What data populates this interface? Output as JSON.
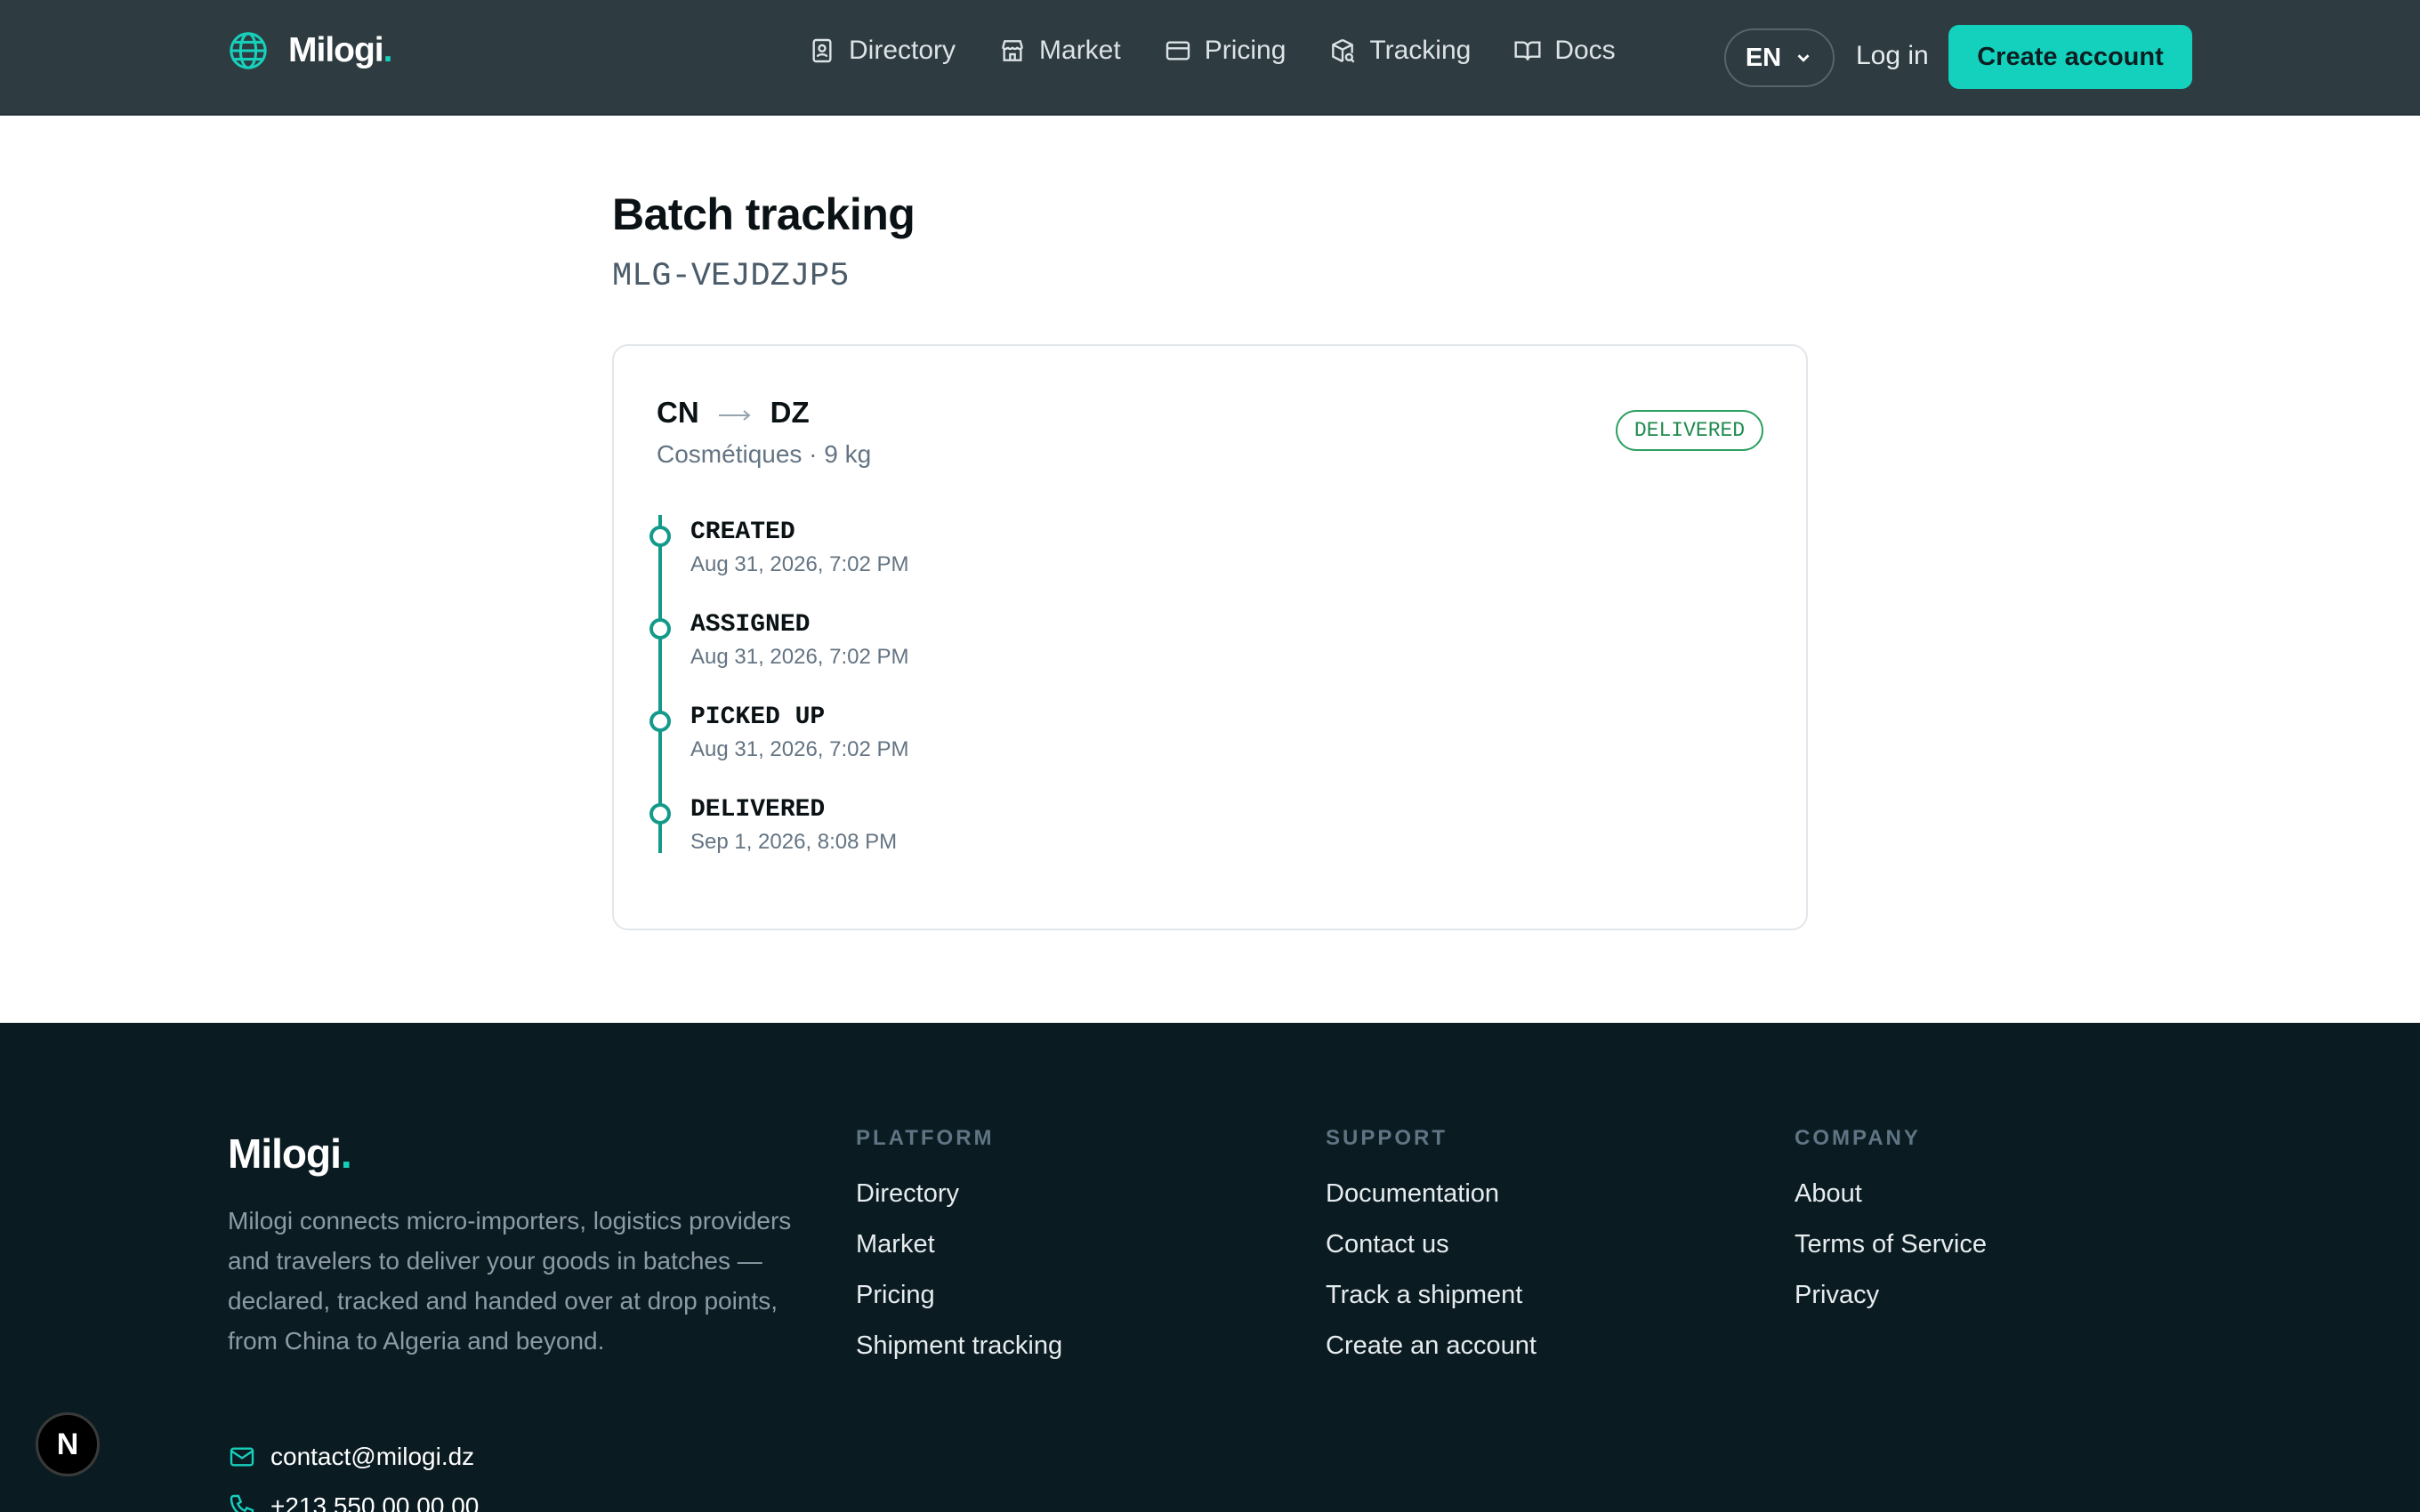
{
  "header": {
    "logo": "Milogi",
    "logo_dot": ".",
    "nav": [
      {
        "label": "Directory",
        "icon": "contact-book-icon"
      },
      {
        "label": "Market",
        "icon": "store-icon"
      },
      {
        "label": "Pricing",
        "icon": "credit-card-icon"
      },
      {
        "label": "Tracking",
        "icon": "package-search-icon"
      },
      {
        "label": "Docs",
        "icon": "book-icon"
      }
    ],
    "language": "EN",
    "login": "Log in",
    "cta": "Create account"
  },
  "main": {
    "title": "Batch tracking",
    "batch_id": "MLG-VEJDZJP5",
    "card": {
      "origin": "CN",
      "destination": "DZ",
      "meta": "Cosmétiques · 9 kg",
      "status": "DELIVERED",
      "events": [
        {
          "label": "CREATED",
          "time": "Aug 31, 2026, 7:02 PM"
        },
        {
          "label": "ASSIGNED",
          "time": "Aug 31, 2026, 7:02 PM"
        },
        {
          "label": "PICKED UP",
          "time": "Aug 31, 2026, 7:02 PM"
        },
        {
          "label": "DELIVERED",
          "time": "Sep 1, 2026, 8:08 PM"
        }
      ]
    }
  },
  "footer": {
    "logo": "Milogi",
    "logo_dot": ".",
    "description": "Milogi connects micro-importers, logistics providers and travelers to deliver your goods in batches — declared, tracked and handed over at drop points, from China to Algeria and beyond.",
    "email": "contact@milogi.dz",
    "phone": "+213 550 00 00 00",
    "columns": [
      {
        "heading": "PLATFORM",
        "links": [
          "Directory",
          "Market",
          "Pricing",
          "Shipment tracking"
        ]
      },
      {
        "heading": "SUPPORT",
        "links": [
          "Documentation",
          "Contact us",
          "Track a shipment",
          "Create an account"
        ]
      },
      {
        "heading": "COMPANY",
        "links": [
          "About",
          "Terms of Service",
          "Privacy"
        ]
      }
    ]
  },
  "dev_badge": "N",
  "colors": {
    "accent": "#14d1bd",
    "header_bg": "#2e3b40",
    "footer_bg": "#0b1b22",
    "timeline": "#139a8a",
    "delivered": "#1f8a4f"
  }
}
